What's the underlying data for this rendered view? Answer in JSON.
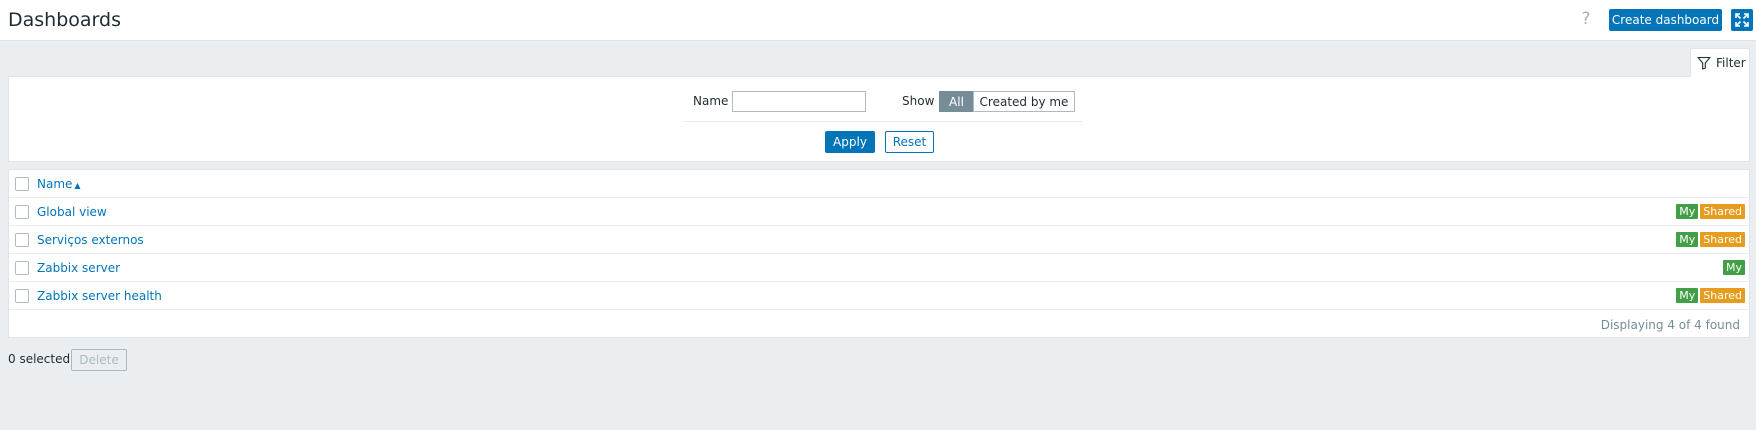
{
  "header": {
    "title": "Dashboards",
    "help_glyph": "?",
    "create_label": "Create dashboard",
    "kiosk_icon": "fullscreen-icon"
  },
  "filter": {
    "tab_label": "Filter",
    "tab_icon": "funnel-icon",
    "name_label": "Name",
    "name_value": "",
    "name_placeholder": "",
    "show_label": "Show",
    "show_options": [
      "All",
      "Created by me"
    ],
    "show_selected": "All",
    "apply_label": "Apply",
    "reset_label": "Reset"
  },
  "table": {
    "column_name": "Name",
    "sort_glyph": "▲",
    "rows": [
      {
        "name": "Global view",
        "tags": [
          "My",
          "Shared"
        ]
      },
      {
        "name": "Serviços externos",
        "tags": [
          "My",
          "Shared"
        ]
      },
      {
        "name": "Zabbix server",
        "tags": [
          "My"
        ]
      },
      {
        "name": "Zabbix server health",
        "tags": [
          "My",
          "Shared"
        ]
      }
    ],
    "footer": "Displaying 4 of 4 found"
  },
  "actions": {
    "selected_text": "0 selected",
    "delete_label": "Delete"
  },
  "colors": {
    "accent": "#0275b8",
    "tag_my": "#429e47",
    "tag_shared": "#e89c1f",
    "background": "#ebeef0"
  }
}
